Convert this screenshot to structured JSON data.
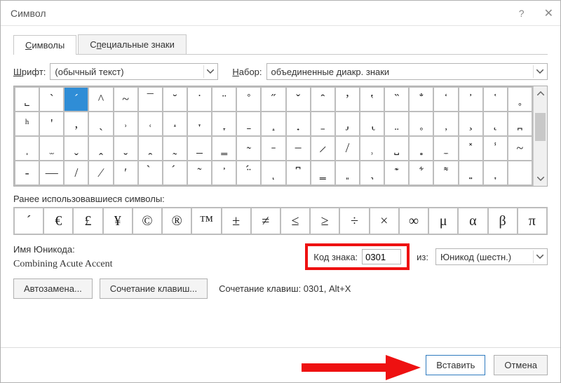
{
  "title": "Символ",
  "tabs": {
    "symbols": "Символы",
    "special": "Специальные знаки"
  },
  "font_label": "Шрифт:",
  "font_value": "(обычный текст)",
  "set_label": "Набор:",
  "set_value": "объединенные диакр. знаки",
  "grid": [
    [
      "˾",
      "`",
      "´",
      "^",
      "~",
      "¯",
      "˘",
      "˙",
      "¨",
      "˚",
      "˝",
      "ˇ",
      "̑",
      "ʼ",
      "ʽ",
      "̏",
      "̐",
      "̒",
      "̓",
      "̔",
      "˳"
    ],
    [
      "ʰ",
      "'",
      ",",
      "ˎ",
      "˒",
      "˓",
      "˔",
      "˕",
      "̞",
      "̱",
      "̝",
      "̟",
      "̠",
      "̡",
      "̢",
      "̤",
      "̥",
      "̦",
      "̧",
      "̨",
      "̪"
    ],
    [
      "̩",
      "̫",
      "̬",
      "̭",
      "̮",
      "̯",
      "̰",
      "̲",
      "̳",
      "̴",
      "̵",
      "̶",
      "̷",
      "̸",
      "̹",
      "̺",
      "̻",
      "̼",
      "̽",
      "̾",
      "~"
    ],
    [
      "-",
      "—",
      "/",
      "∕",
      "ʹ",
      "̀",
      "́",
      "͂",
      "̓",
      "̈́",
      "ͅ",
      "͆",
      "͇",
      "͈",
      "͉",
      "͊",
      "͋",
      "͌",
      "͍",
      "͎",
      "͏"
    ]
  ],
  "selected": {
    "row": 0,
    "col": 2
  },
  "recent_label": "Ранее использовавшиеся символы:",
  "recent": [
    "´",
    "€",
    "£",
    "¥",
    "©",
    "®",
    "™",
    "±",
    "≠",
    "≤",
    "≥",
    "÷",
    "×",
    "∞",
    "μ",
    "α",
    "β",
    "π"
  ],
  "unicode_name_label": "Имя Юникода:",
  "unicode_name": "Combining Acute Accent",
  "code_label": "Код знака:",
  "code_value": "0301",
  "from_label": "из:",
  "from_value": "Юникод (шестн.)",
  "autocorrect_btn": "Автозамена...",
  "shortcut_btn": "Сочетание клавиш...",
  "shortcut_text": "Сочетание клавиш: 0301, Alt+X",
  "insert_btn": "Вставить",
  "cancel_btn": "Отмена"
}
